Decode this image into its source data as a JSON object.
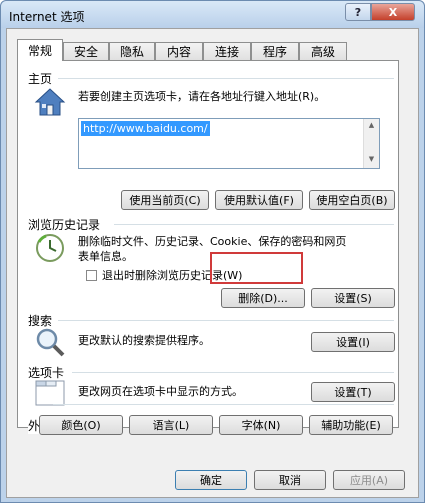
{
  "window": {
    "title": "Internet 选项",
    "help": "?",
    "close": "X"
  },
  "tabs": [
    "常规",
    "安全",
    "隐私",
    "内容",
    "连接",
    "程序",
    "高级"
  ],
  "home": {
    "heading": "主页",
    "description": "若要创建主页选项卡，请在各地址行键入地址(R)。",
    "url": "http://www.baidu.com/",
    "buttons": [
      "使用当前页(C)",
      "使用默认值(F)",
      "使用空白页(B)"
    ]
  },
  "history": {
    "heading": "浏览历史记录",
    "description_line1": "删除临时文件、历史记录、Cookie、保存的密码和网页",
    "description_line2": "表单信息。",
    "checkbox_label": "退出时删除浏览历史记录(W)",
    "delete_button": "删除(D)...",
    "settings_button": "设置(S)"
  },
  "search": {
    "heading": "搜索",
    "description": "更改默认的搜索提供程序。",
    "settings_button": "设置(I)"
  },
  "tabs_section": {
    "heading": "选项卡",
    "description": "更改网页在选项卡中显示的方式。",
    "settings_button": "设置(T)"
  },
  "appearance": {
    "heading": "外观",
    "buttons": [
      "颜色(O)",
      "语言(L)",
      "字体(N)",
      "辅助功能(E)"
    ]
  },
  "footer": {
    "ok": "确定",
    "cancel": "取消",
    "apply": "应用(A)"
  },
  "colors": {
    "accent": "#3399ff",
    "highlight": "#d03a3a"
  }
}
